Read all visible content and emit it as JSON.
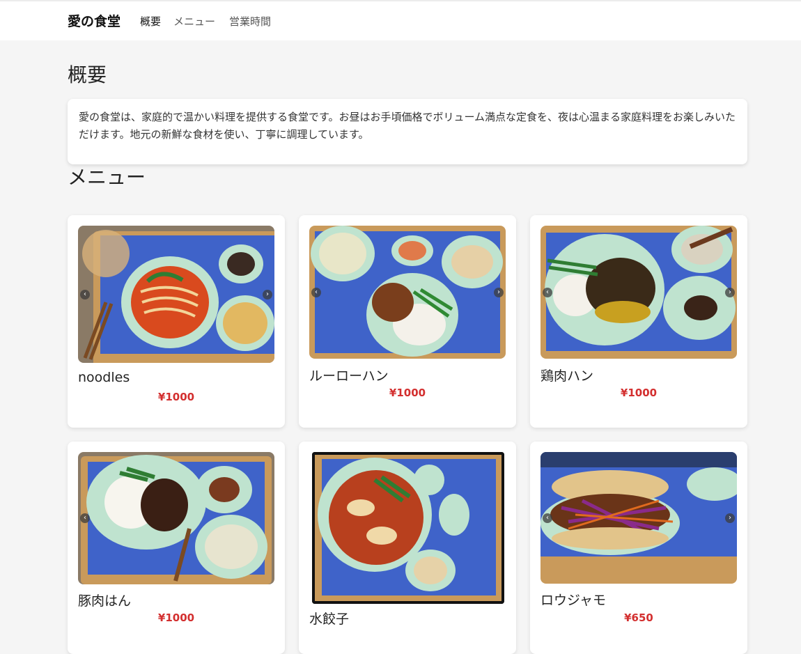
{
  "nav": {
    "brand": "愛の食堂",
    "links": [
      {
        "label": "概要"
      },
      {
        "label": "メニュー"
      },
      {
        "label": "営業時間"
      }
    ]
  },
  "about": {
    "title": "概要",
    "text": "愛の食堂は、家庭的で温かい料理を提供する食堂です。お昼はお手頃価格でボリューム満点な定食を、夜は心温まる家庭料理をお楽しみいただけます。地元の新鮮な食材を使い、丁寧に調理しています。"
  },
  "menu": {
    "title": "メニュー",
    "items": [
      {
        "name": "noodles",
        "price": "¥1000",
        "image": "beef-noodle-soup-photo"
      },
      {
        "name": "ルーローハン",
        "price": "¥1000",
        "image": "braised-pork-rice-photo"
      },
      {
        "name": "鶏肉ハン",
        "price": "¥1000",
        "image": "chicken-rice-photo"
      },
      {
        "name": "豚肉はん",
        "price": "¥1000",
        "image": "pork-rice-photo"
      },
      {
        "name": "水餃子",
        "price": "",
        "image": "dumpling-soup-photo"
      },
      {
        "name": "ロウジャモ",
        "price": "¥650",
        "image": "roujiamo-photo"
      }
    ]
  },
  "colors": {
    "price": "#d32f2f",
    "page_bg": "#f5f5f5",
    "placemat": "#3f63c9",
    "tray": "#c99a5b",
    "bowl": "#bfe3cf"
  }
}
